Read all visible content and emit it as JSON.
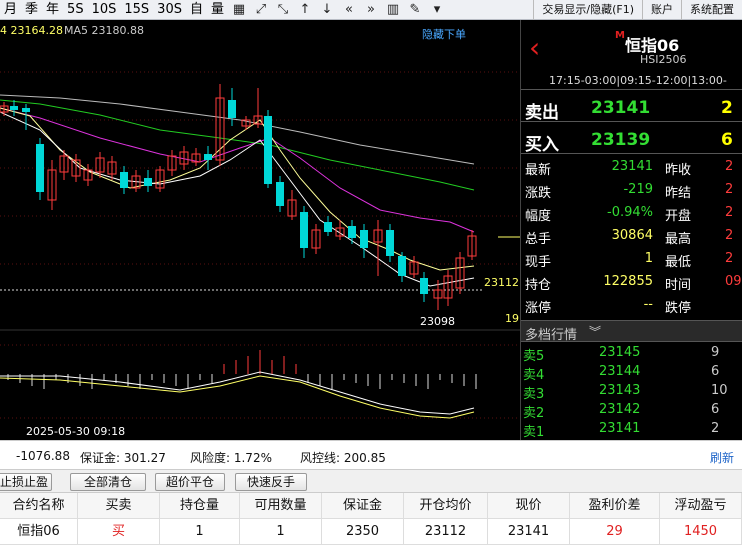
{
  "toolbar": {
    "periods": [
      "月",
      "季",
      "年",
      "5S",
      "10S",
      "15S",
      "30S"
    ],
    "tool_labels": [
      "自",
      "量"
    ],
    "right": [
      "交易显示/隐藏(F1)",
      "账户",
      "系统配置"
    ]
  },
  "chart": {
    "ma_label_1": "4 23164.28",
    "ma_label_2": "MA5 23180.88",
    "hide_order": "隐藏下单",
    "price_tag": "23112",
    "low_label": "23098",
    "right_cut": "19",
    "date_label": "2025-05-30 09:18"
  },
  "chart_data": {
    "type": "candlestick",
    "series": [
      {
        "name": "MA5",
        "current": 23180.88
      },
      {
        "name": "MA",
        "current": 23164.28
      }
    ],
    "lowest": 23098,
    "reference_line": 23112
  },
  "quote": {
    "title": "恒指06",
    "code": "HSI2506",
    "session": "17:15-03:00|09:15-12:00|13:00-",
    "sell_label": "卖出",
    "sell_price": "23141",
    "sell_qty": "2",
    "buy_label": "买入",
    "buy_price": "23139",
    "buy_qty": "6",
    "stats": [
      {
        "label": "最新",
        "value": "23141",
        "label2": "昨收",
        "value2": "2"
      },
      {
        "label": "涨跌",
        "value": "-219",
        "label2": "昨结",
        "value2": "2"
      },
      {
        "label": "幅度",
        "value": "-0.94%",
        "label2": "开盘",
        "value2": "2"
      },
      {
        "label": "总手",
        "value": "30864",
        "label2": "最高",
        "value2": "2"
      },
      {
        "label": "现手",
        "value": "1",
        "label2": "最低",
        "value2": "2"
      },
      {
        "label": "持仓",
        "value": "122855",
        "label2": "时间",
        "value2": "09:"
      },
      {
        "label": "涨停",
        "value": "--",
        "label2": "跌停",
        "value2": ""
      }
    ],
    "depth_title": "多档行情",
    "depth": [
      {
        "label": "卖5",
        "price": "23145",
        "qty": "9"
      },
      {
        "label": "卖4",
        "price": "23144",
        "qty": "6"
      },
      {
        "label": "卖3",
        "price": "23143",
        "qty": "10"
      },
      {
        "label": "卖2",
        "price": "23142",
        "qty": "6"
      },
      {
        "label": "卖1",
        "price": "23141",
        "qty": "2"
      }
    ]
  },
  "status": {
    "pnl": "-1076.88",
    "margin": "保证金: 301.27",
    "risk": "风险度: 1.72%",
    "risk_line": "风控线: 200.85",
    "refresh": "刷新"
  },
  "buttons": {
    "stop": "止损止盈",
    "close_all": "全部清仓",
    "super_close": "超价平仓",
    "reverse": "快速反手"
  },
  "table": {
    "headers": [
      "合约名称",
      "买卖",
      "持仓量",
      "可用数量",
      "保证金",
      "开仓均价",
      "现价",
      "盈利价差",
      "浮动盈亏"
    ],
    "row": [
      "恒指06",
      "买",
      "1",
      "1",
      "2350",
      "23112",
      "23141",
      "29",
      "1450"
    ]
  },
  "colors": {
    "up": "#ff3c3c",
    "down": "#00d8d8",
    "green": "#33dd33",
    "yellow": "#ffff00"
  }
}
